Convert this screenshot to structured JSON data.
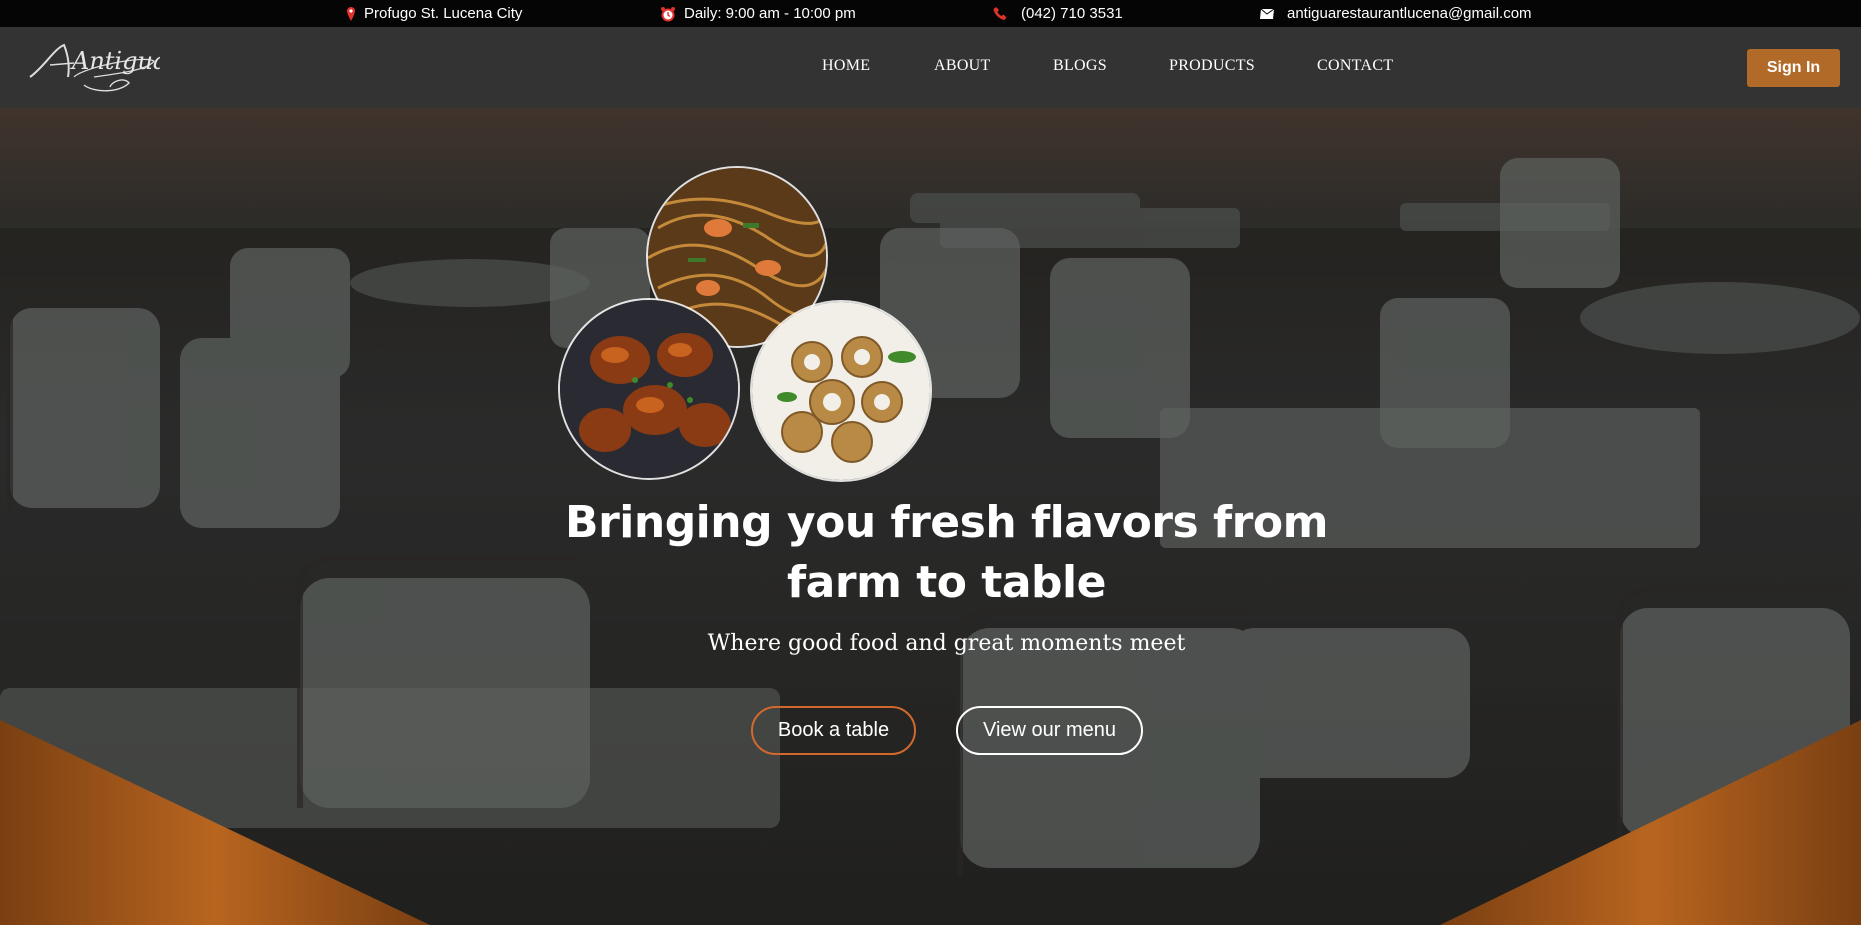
{
  "topbar": {
    "address": "Profugo St. Lucena City",
    "hours": "Daily: 9:00 am - 10:00 pm",
    "phone": "(042) 710 3531",
    "email": "antiguarestaurantlucena@gmail.com"
  },
  "brand": {
    "logo_text": "Antigua"
  },
  "nav": {
    "home": "HOME",
    "about": "ABOUT",
    "blogs": "BLOGS",
    "products": "PRODUCTS",
    "contact": "CONTACT",
    "signin": "Sign In"
  },
  "hero": {
    "headline_line1": "Bringing you fresh flavors from",
    "headline_line2": "farm to table",
    "subline": "Where good food and great moments meet",
    "book_button": "Book a table",
    "menu_button": "View our menu"
  },
  "icons": {
    "address": "map-pin-icon",
    "hours": "alarm-clock-icon",
    "phone": "phone-icon",
    "email": "envelope-icon"
  },
  "colors": {
    "accent": "#b26a28",
    "button_border_accent": "#d2692c",
    "icon_red": "#e0312b",
    "topbar_bg": "#050505",
    "navbar_bg": "#333333"
  }
}
